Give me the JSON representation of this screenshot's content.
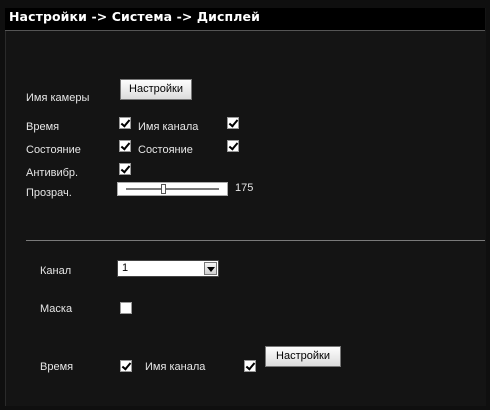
{
  "header": {
    "title": "Настройки -> Система -> Дисплей"
  },
  "camera": {
    "name_label": "Имя камеры",
    "settings_button": "Настройки"
  },
  "osd": {
    "time_label": "Время",
    "time_checked": true,
    "channel_name_label": "Имя канала",
    "channel_name_checked": true,
    "status_label": "Состояние",
    "status_checked": true,
    "status2_label": "Состояние",
    "status2_checked": true,
    "antishake_label": "Антивибр.",
    "antishake_checked": true,
    "transparency_label": "Прозрач.",
    "transparency_value": "175",
    "transparency_fraction": 0.4
  },
  "channel": {
    "channel_label": "Канал",
    "channel_value": "1",
    "mask_label": "Маска",
    "mask_checked": false,
    "time_label": "Время",
    "time_checked": true,
    "channel_name_label": "Имя канала",
    "channel_name_checked": true,
    "settings_button": "Настройки"
  }
}
